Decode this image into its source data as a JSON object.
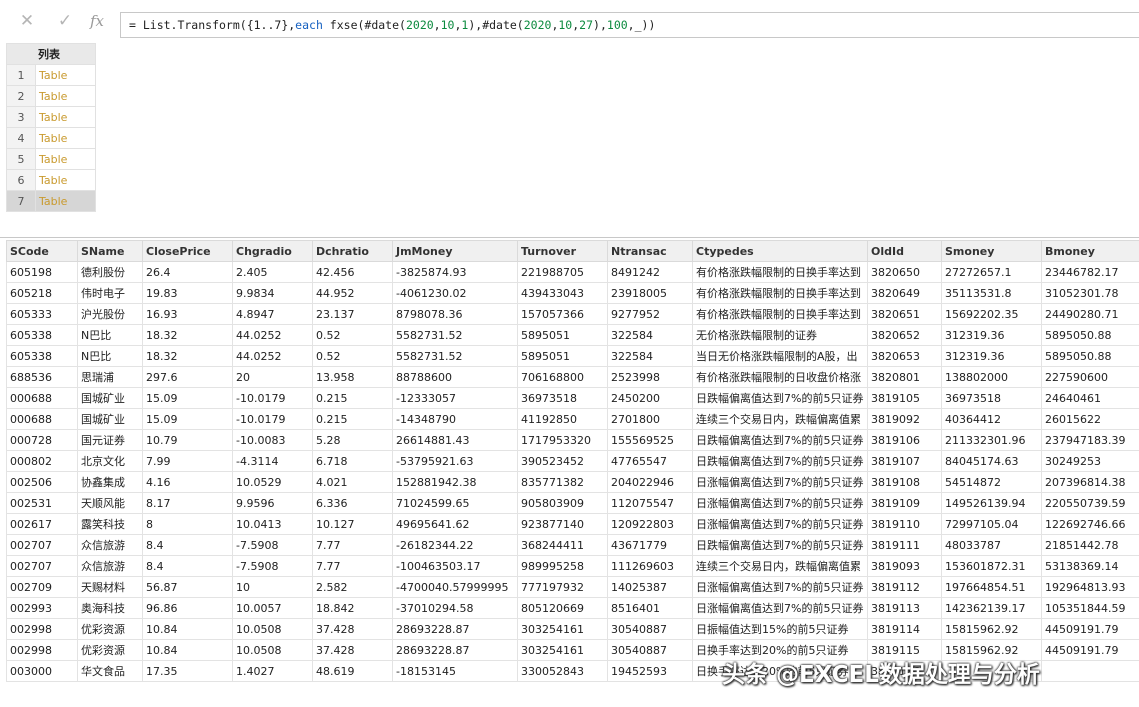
{
  "toolbar": {
    "cancel_icon": "✕",
    "confirm_icon": "✓",
    "fx_label": "fx"
  },
  "formula": {
    "p1": "= List.Transform({1..7},",
    "kw": "each",
    "p2": " fxse(#date(",
    "n1": "2020",
    "c1": ",",
    "n2": "10",
    "c2": ",",
    "n3": "1",
    "p3": "),#date(",
    "n4": "2020",
    "c3": ",",
    "n5": "10",
    "c4": ",",
    "n6": "27",
    "p4": "),",
    "n7": "100",
    "p5": ",_))"
  },
  "list": {
    "header": "列表",
    "rows": [
      {
        "index": "1",
        "value": "Table"
      },
      {
        "index": "2",
        "value": "Table"
      },
      {
        "index": "3",
        "value": "Table"
      },
      {
        "index": "4",
        "value": "Table"
      },
      {
        "index": "5",
        "value": "Table"
      },
      {
        "index": "6",
        "value": "Table"
      },
      {
        "index": "7",
        "value": "Table"
      }
    ]
  },
  "table": {
    "columns": [
      "SCode",
      "SName",
      "ClosePrice",
      "Chgradio",
      "Dchratio",
      "JmMoney",
      "Turnover",
      "Ntransac",
      "Ctypedes",
      "OldId",
      "Smoney",
      "Bmoney"
    ],
    "rows": [
      [
        "605198",
        "德利股份",
        "26.4",
        "2.405",
        "42.456",
        "-3825874.93",
        "221988705",
        "8491242",
        "有价格涨跌幅限制的日换手率达到",
        "3820650",
        "27272657.1",
        "23446782.17"
      ],
      [
        "605218",
        "伟时电子",
        "19.83",
        "9.9834",
        "44.952",
        "-4061230.02",
        "439433043",
        "23918005",
        "有价格涨跌幅限制的日换手率达到",
        "3820649",
        "35113531.8",
        "31052301.78"
      ],
      [
        "605333",
        "沪光股份",
        "16.93",
        "4.8947",
        "23.137",
        "8798078.36",
        "157057366",
        "9277952",
        "有价格涨跌幅限制的日换手率达到",
        "3820651",
        "15692202.35",
        "24490280.71"
      ],
      [
        "605338",
        "N巴比",
        "18.32",
        "44.0252",
        "0.52",
        "5582731.52",
        "5895051",
        "322584",
        "无价格涨跌幅限制的证券",
        "3820652",
        "312319.36",
        "5895050.88"
      ],
      [
        "605338",
        "N巴比",
        "18.32",
        "44.0252",
        "0.52",
        "5582731.52",
        "5895051",
        "322584",
        "当日无价格涨跌幅限制的A股，出",
        "3820653",
        "312319.36",
        "5895050.88"
      ],
      [
        "688536",
        "思瑞浦",
        "297.6",
        "20",
        "13.958",
        "88788600",
        "706168800",
        "2523998",
        "有价格涨跌幅限制的日收盘价格涨",
        "3820801",
        "138802000",
        "227590600"
      ],
      [
        "000688",
        "国城矿业",
        "15.09",
        "-10.0179",
        "0.215",
        "-12333057",
        "36973518",
        "2450200",
        "日跌幅偏离值达到7%的前5只证券",
        "3819105",
        "36973518",
        "24640461"
      ],
      [
        "000688",
        "国城矿业",
        "15.09",
        "-10.0179",
        "0.215",
        "-14348790",
        "41192850",
        "2701800",
        "连续三个交易日内，跌幅偏离值累",
        "3819092",
        "40364412",
        "26015622"
      ],
      [
        "000728",
        "国元证券",
        "10.79",
        "-10.0083",
        "5.28",
        "26614881.43",
        "1717953320",
        "155569525",
        "日跌幅偏离值达到7%的前5只证券",
        "3819106",
        "211332301.96",
        "237947183.39"
      ],
      [
        "000802",
        "北京文化",
        "7.99",
        "-4.3114",
        "6.718",
        "-53795921.63",
        "390523452",
        "47765547",
        "日跌幅偏离值达到7%的前5只证券",
        "3819107",
        "84045174.63",
        "30249253"
      ],
      [
        "002506",
        "协鑫集成",
        "4.16",
        "10.0529",
        "4.021",
        "152881942.38",
        "835771382",
        "204022946",
        "日涨幅偏离值达到7%的前5只证券",
        "3819108",
        "54514872",
        "207396814.38"
      ],
      [
        "002531",
        "天顺风能",
        "8.17",
        "9.9596",
        "6.336",
        "71024599.65",
        "905803909",
        "112075547",
        "日涨幅偏离值达到7%的前5只证券",
        "3819109",
        "149526139.94",
        "220550739.59"
      ],
      [
        "002617",
        "露笑科技",
        "8",
        "10.0413",
        "10.127",
        "49695641.62",
        "923877140",
        "120922803",
        "日涨幅偏离值达到7%的前5只证券",
        "3819110",
        "72997105.04",
        "122692746.66"
      ],
      [
        "002707",
        "众信旅游",
        "8.4",
        "-7.5908",
        "7.77",
        "-26182344.22",
        "368244411",
        "43671779",
        "日跌幅偏离值达到7%的前5只证券",
        "3819111",
        "48033787",
        "21851442.78"
      ],
      [
        "002707",
        "众信旅游",
        "8.4",
        "-7.5908",
        "7.77",
        "-100463503.17",
        "989995258",
        "111269603",
        "连续三个交易日内，跌幅偏离值累",
        "3819093",
        "153601872.31",
        "53138369.14"
      ],
      [
        "002709",
        "天赐材料",
        "56.87",
        "10",
        "2.582",
        "-4700040.57999995",
        "777197932",
        "14025387",
        "日涨幅偏离值达到7%的前5只证券",
        "3819112",
        "197664854.51",
        "192964813.93"
      ],
      [
        "002993",
        "奥海科技",
        "96.86",
        "10.0057",
        "18.842",
        "-37010294.58",
        "805120669",
        "8516401",
        "日涨幅偏离值达到7%的前5只证券",
        "3819113",
        "142362139.17",
        "105351844.59"
      ],
      [
        "002998",
        "优彩资源",
        "10.84",
        "10.0508",
        "37.428",
        "28693228.87",
        "303254161",
        "30540887",
        "日振幅值达到15%的前5只证券",
        "3819114",
        "15815962.92",
        "44509191.79"
      ],
      [
        "002998",
        "优彩资源",
        "10.84",
        "10.0508",
        "37.428",
        "28693228.87",
        "303254161",
        "30540887",
        "日换手率达到20%的前5只证券",
        "3819115",
        "15815962.92",
        "44509191.79"
      ],
      [
        "003000",
        "华文食品",
        "17.35",
        "1.4027",
        "48.619",
        "-18153145",
        "330052843",
        "19452593",
        "日换手率达到20%的前5只证券",
        "3819116",
        "",
        ""
      ]
    ]
  },
  "watermark": "头条 @EXCEL数据处理与分析"
}
